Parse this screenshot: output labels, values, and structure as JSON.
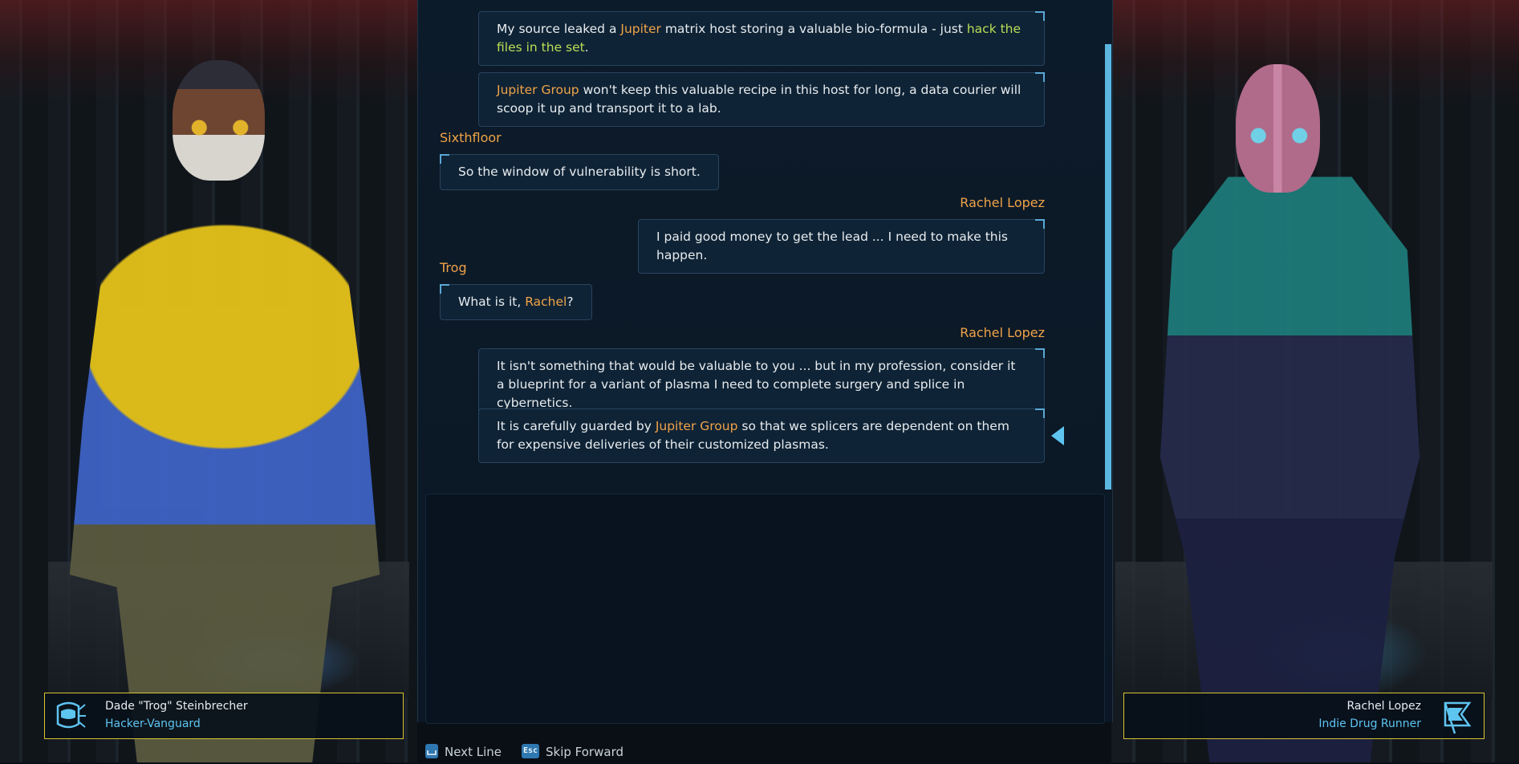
{
  "dialog": {
    "messages": [
      {
        "speaker": "",
        "side": "right",
        "parts": [
          {
            "text": "My source leaked a ",
            "style": "normal"
          },
          {
            "text": "Jupiter",
            "style": "org"
          },
          {
            "text": " matrix host storing a valuable bio-formula - just ",
            "style": "normal"
          },
          {
            "text": "hack the files in the set",
            "style": "action"
          },
          {
            "text": ".",
            "style": "normal"
          }
        ]
      },
      {
        "speaker": "",
        "side": "right",
        "parts": [
          {
            "text": "Jupiter Group",
            "style": "org"
          },
          {
            "text": " won't keep this valuable recipe in this host for long, a data courier will scoop it up and transport it to a lab.",
            "style": "normal"
          }
        ]
      },
      {
        "speaker": "Sixthfloor",
        "side": "left",
        "parts": [
          {
            "text": "So the window of vulnerability is short.",
            "style": "normal"
          }
        ]
      },
      {
        "speaker": "Rachel Lopez",
        "side": "right",
        "parts": [
          {
            "text": "I paid good money to get the lead ... I need to make this happen.",
            "style": "normal"
          }
        ]
      },
      {
        "speaker": "Trog",
        "side": "left",
        "parts": [
          {
            "text": "What is it, ",
            "style": "normal"
          },
          {
            "text": "Rachel",
            "style": "org"
          },
          {
            "text": "?",
            "style": "normal"
          }
        ]
      },
      {
        "speaker": "Rachel Lopez",
        "side": "right",
        "parts": [
          {
            "text": "It isn't something that would be valuable to you ... but in my profession, consider it a blueprint for a variant of plasma I need to complete surgery and splice in cybernetics.",
            "style": "normal"
          }
        ]
      },
      {
        "speaker": "",
        "side": "right",
        "current": true,
        "parts": [
          {
            "text": "It is carefully guarded by ",
            "style": "normal"
          },
          {
            "text": "Jupiter Group",
            "style": "org"
          },
          {
            "text": " so that we splicers are dependent on them for expensive deliveries of their customized plasmas.",
            "style": "normal"
          }
        ]
      }
    ]
  },
  "left_character": {
    "name": "Dade \"Trog\" Steinbrecher",
    "role": "Hacker-Vanguard",
    "icon": "hacker-vanguard-icon"
  },
  "right_character": {
    "name": "Rachel Lopez",
    "role": "Indie Drug Runner",
    "icon": "flag-icon"
  },
  "controls": {
    "next": {
      "key": "space-key-icon",
      "label": "Next Line"
    },
    "skip": {
      "key": "Esc",
      "label": "Skip Forward"
    }
  },
  "colors": {
    "speaker": "#f0a347",
    "org_highlight": "#f0a347",
    "action_highlight": "#b9df55",
    "role_text": "#5ec4f0",
    "plate_border": "#d8c532"
  }
}
